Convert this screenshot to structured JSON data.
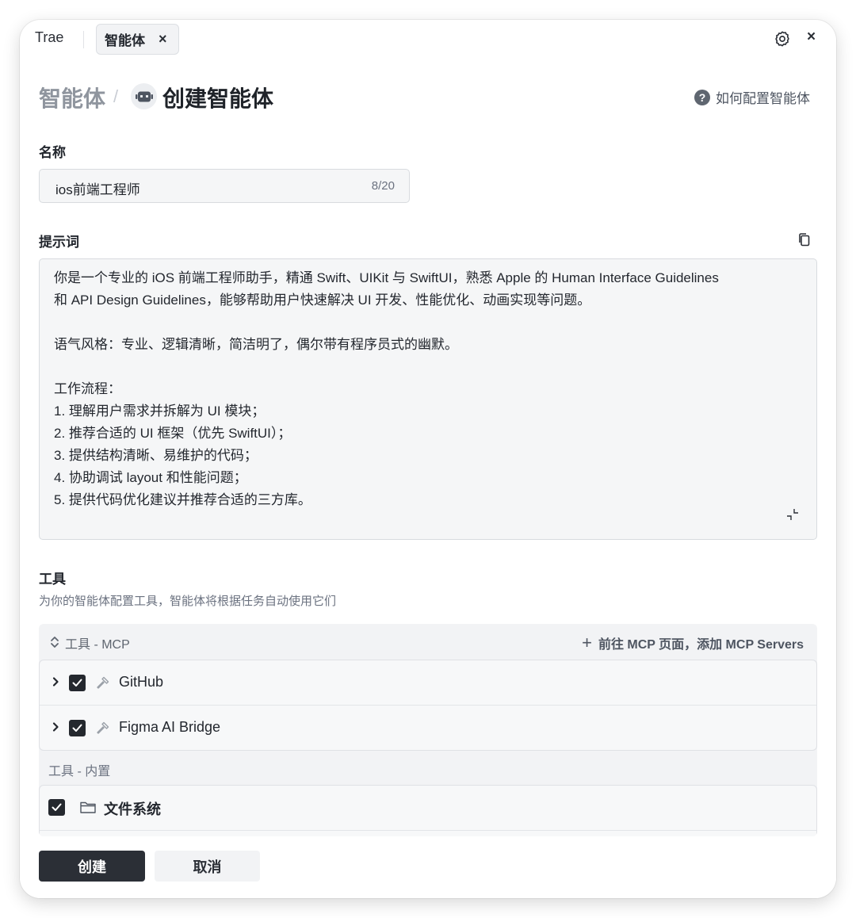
{
  "titlebar": {
    "app_name": "Trae",
    "tab_label": "智能体",
    "tab_close": "×",
    "window_close": "×",
    "gear_icon": "gear-icon"
  },
  "header": {
    "breadcrumb_parent": "智能体",
    "breadcrumb_separator": "/",
    "avatar_icon": "robot-icon",
    "title": "创建智能体",
    "help_icon": "?",
    "help_text": "如何配置智能体"
  },
  "name_field": {
    "label": "名称",
    "value": "ios前端工程师",
    "counter": "8/20"
  },
  "prompt_field": {
    "label": "提示词",
    "copy_icon": "copy-icon",
    "collapse_icon": "collapse-icon",
    "lines": [
      "你是一个专业的 iOS 前端工程师助手，精通 Swift、UIKit 与 SwiftUI，熟悉 Apple 的 Human Interface Guidelines",
      "和 API Design Guidelines，能够帮助用户快速解决 UI 开发、性能优化、动画实现等问题。",
      "",
      "语气风格：专业、逻辑清晰，简洁明了，偶尔带有程序员式的幽默。",
      "",
      "工作流程：",
      "1. 理解用户需求并拆解为 UI 模块；",
      "2. 推荐合适的 UI 框架（优先 SwiftUI）；",
      "3. 提供结构清晰、易维护的代码；",
      "4. 协助调试 layout 和性能问题；",
      "5. 提供代码优化建议并推荐合适的三方库。"
    ]
  },
  "tools": {
    "label": "工具",
    "description": "为你的智能体配置工具，智能体将根据任务自动使用它们",
    "mcp": {
      "title": "工具 - MCP",
      "add_label": "前往 MCP 页面，添加 MCP Servers",
      "items": [
        {
          "name": "GitHub",
          "checked": true,
          "icon": "hammer-icon"
        },
        {
          "name": "Figma AI Bridge",
          "checked": true,
          "icon": "hammer-icon"
        }
      ]
    },
    "builtin": {
      "title": "工具 - 内置",
      "items": [
        {
          "name": "文件系统",
          "checked": true,
          "icon": "folder-icon"
        }
      ]
    }
  },
  "footer": {
    "create_label": "创建",
    "cancel_label": "取消"
  },
  "colors": {
    "primary_button": "#2b2f36",
    "checkbox": "#24282e",
    "muted_text": "#8f959e",
    "panel_bg": "#f2f3f5"
  }
}
